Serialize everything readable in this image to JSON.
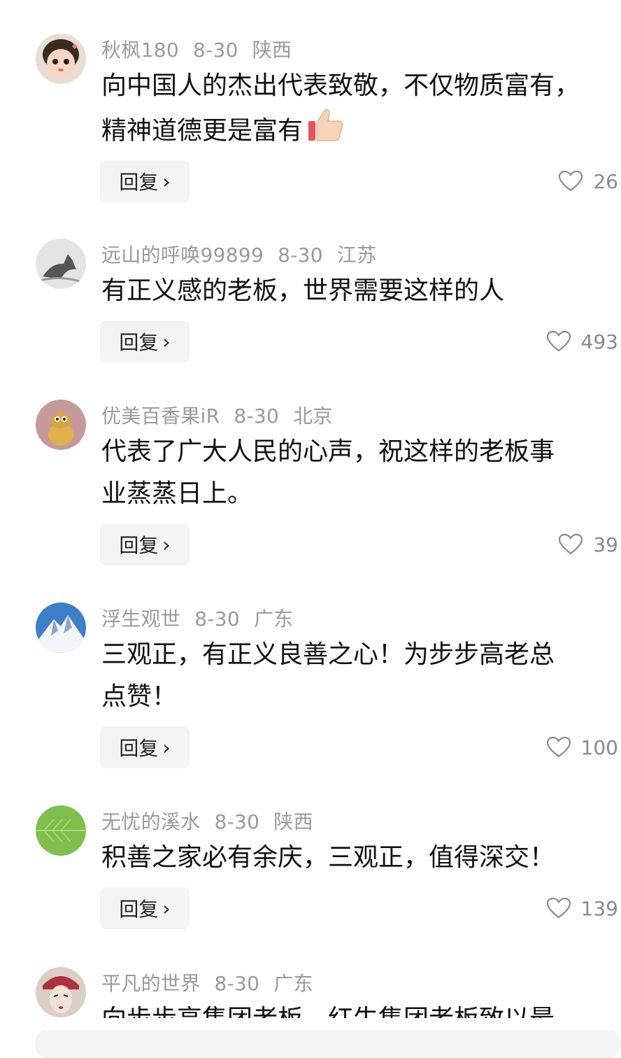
{
  "comments": [
    {
      "user": "秋枫180",
      "date": "8-30",
      "location": "陕西",
      "line1": "向中国人的杰出代表致敬，不仅物质富有，",
      "line2": "精神道德更是富有",
      "reply": "回复",
      "likes": "26",
      "avatar_icon": "girl-avatar-icon"
    },
    {
      "user": "远山的呼唤99899",
      "date": "8-30",
      "location": "江苏",
      "line1": "有正义感的老板，世界需要这样的人",
      "line2": "",
      "reply": "回复",
      "likes": "493",
      "avatar_icon": "horse-avatar-icon"
    },
    {
      "user": "优美百香果iR",
      "date": "8-30",
      "location": "北京",
      "line1": "代表了广大人民的心声，祝这样的老板事",
      "line2": "业蒸蒸日上。",
      "reply": "回复",
      "likes": "39",
      "avatar_icon": "cartoon-avatar-icon"
    },
    {
      "user": "浮生观世",
      "date": "8-30",
      "location": "广东",
      "line1": "三观正，有正义良善之心！为步步高老总",
      "line2": "点赞！",
      "reply": "回复",
      "likes": "100",
      "avatar_icon": "mountain-avatar-icon"
    },
    {
      "user": "无忧的溪水",
      "date": "8-30",
      "location": "陕西",
      "line1": "积善之家必有余庆，三观正，值得深交！",
      "line2": "",
      "reply": "回复",
      "likes": "139",
      "avatar_icon": "leaf-avatar-icon"
    },
    {
      "user": "平凡的世界",
      "date": "8-30",
      "location": "广东",
      "line1": "向步步高集团老板，红牛集团老板致以最",
      "line2": "",
      "reply": "",
      "likes": "",
      "avatar_icon": "opera-avatar-icon"
    }
  ],
  "colors": {
    "meta": "#9a9a9a",
    "text": "#111111",
    "reply_bg": "#f4f4f4"
  }
}
